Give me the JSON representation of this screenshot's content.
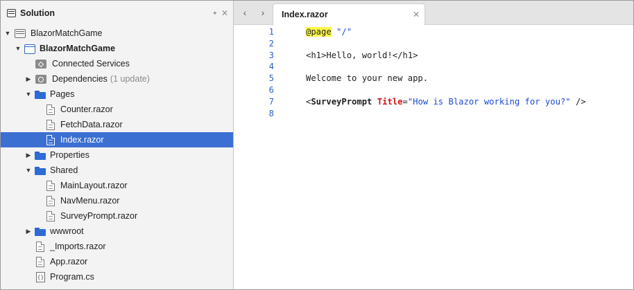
{
  "solution_pad": {
    "title": "Solution",
    "pin_glyph": "✦",
    "close_glyph": "✕",
    "tree": [
      {
        "label": "BlazorMatchGame",
        "icon": "solution-icon",
        "expanded": true,
        "indent": 0
      },
      {
        "label": "BlazorMatchGame",
        "icon": "project-icon",
        "expanded": true,
        "bold": true,
        "indent": 1
      },
      {
        "label": "Connected Services",
        "icon": "connected-services-icon",
        "indent": 2
      },
      {
        "label": "Dependencies",
        "hint": "(1 update)",
        "icon": "dependencies-icon",
        "collapsed": true,
        "indent": 2
      },
      {
        "label": "Pages",
        "icon": "folder-icon",
        "expanded": true,
        "indent": 2
      },
      {
        "label": "Counter.razor",
        "icon": "razor-file-icon",
        "indent": 3
      },
      {
        "label": "FetchData.razor",
        "icon": "razor-file-icon",
        "indent": 3
      },
      {
        "label": "Index.razor",
        "icon": "razor-file-icon",
        "indent": 3,
        "selected": true
      },
      {
        "label": "Properties",
        "icon": "folder-icon",
        "collapsed": true,
        "indent": 2
      },
      {
        "label": "Shared",
        "icon": "folder-icon",
        "expanded": true,
        "indent": 2
      },
      {
        "label": "MainLayout.razor",
        "icon": "razor-file-icon",
        "indent": 3
      },
      {
        "label": "NavMenu.razor",
        "icon": "razor-file-icon",
        "indent": 3
      },
      {
        "label": "SurveyPrompt.razor",
        "icon": "razor-file-icon",
        "indent": 3
      },
      {
        "label": "wwwroot",
        "icon": "folder-icon",
        "collapsed": true,
        "indent": 2
      },
      {
        "label": "_Imports.razor",
        "icon": "razor-file-icon",
        "indent": 2
      },
      {
        "label": "App.razor",
        "icon": "razor-file-icon",
        "indent": 2
      },
      {
        "label": "Program.cs",
        "icon": "csharp-file-icon",
        "indent": 2
      }
    ]
  },
  "editor": {
    "nav_back": "‹",
    "nav_forward": "›",
    "tab": {
      "label": "Index.razor",
      "close_glyph": "✕"
    },
    "lines": [
      {
        "n": "1",
        "tokens": [
          {
            "t": "@page",
            "k": "directive"
          },
          {
            "t": " ",
            "k": ""
          },
          {
            "t": "\"/\"",
            "k": "string"
          }
        ]
      },
      {
        "n": "2",
        "tokens": []
      },
      {
        "n": "3",
        "tokens": [
          {
            "t": "<h1>Hello, world!</h1>",
            "k": ""
          }
        ]
      },
      {
        "n": "4",
        "tokens": []
      },
      {
        "n": "5",
        "tokens": [
          {
            "t": "Welcome to your new app.",
            "k": ""
          }
        ]
      },
      {
        "n": "6",
        "tokens": []
      },
      {
        "n": "7",
        "tokens": [
          {
            "t": "<",
            "k": ""
          },
          {
            "t": "SurveyPrompt",
            "k": "tag"
          },
          {
            "t": " ",
            "k": ""
          },
          {
            "t": "Title",
            "k": "attr"
          },
          {
            "t": "=",
            "k": ""
          },
          {
            "t": "\"How is Blazor working for you?\"",
            "k": "string"
          },
          {
            "t": " />",
            "k": ""
          }
        ]
      },
      {
        "n": "8",
        "tokens": []
      }
    ]
  },
  "colors": {
    "selection": "#3b6fd2",
    "line_numbers": "#2f5fbf",
    "string": "#1c47d6",
    "attribute": "#d0101a",
    "directive_highlight": "#fff94a"
  }
}
